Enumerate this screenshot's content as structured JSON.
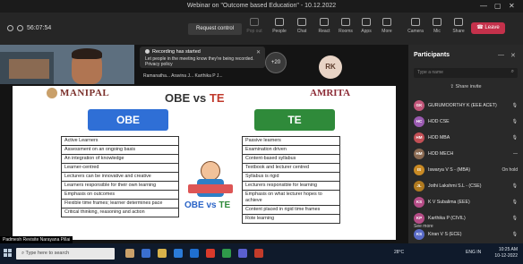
{
  "window": {
    "title": "Webinar on \"Outcome based Education\" - 10.12.2022",
    "controls": [
      "—",
      "▢",
      "✕"
    ]
  },
  "toolbar": {
    "timer": "56:07:54",
    "request_control": "Request control",
    "buttons": [
      {
        "label": "Pop out",
        "icon": "popout-icon",
        "enabled": false
      },
      {
        "label": "People",
        "icon": "people-icon",
        "enabled": true
      },
      {
        "label": "Chat",
        "icon": "chat-icon",
        "enabled": true
      },
      {
        "label": "React",
        "icon": "react-icon",
        "enabled": true
      },
      {
        "label": "Rooms",
        "icon": "rooms-icon",
        "enabled": true
      },
      {
        "label": "Apps",
        "icon": "apps-icon",
        "enabled": true
      },
      {
        "label": "More",
        "icon": "more-icon",
        "enabled": true
      },
      {
        "label": "Camera",
        "icon": "camera-icon",
        "enabled": true
      },
      {
        "label": "Mic",
        "icon": "mic-icon",
        "enabled": true
      },
      {
        "label": "Share",
        "icon": "share-icon",
        "enabled": true
      }
    ],
    "leave": "Leave"
  },
  "stage": {
    "recording_title": "Recording has started",
    "recording_body": "Let people in the meeting know they're being recorded. Privacy policy",
    "names_row": "Ramanatha...    Aravina J...    Karthika P J...",
    "more_count": "+20",
    "rk_initials": "RK",
    "presenter_name": "Padmesh Revisite Narayana Pillai"
  },
  "slide": {
    "logo_left": "MANIPAL",
    "logo_right": "AMRITA",
    "title_obe": "OBE",
    "title_vs": "vs",
    "title_te": "TE",
    "box_obe": "OBE",
    "box_te": "TE",
    "obe_list": [
      "Active Learners",
      "Assessment on an ongoing basis",
      "An integration of knowledge",
      "Learner-centred",
      "Lecturers can be innovative and creative",
      "Learners responsible for their own learning",
      "Emphasis on outcomes",
      "Flexible time frames; learner determines pace",
      "Critical thinking, reasoning and action"
    ],
    "te_list": [
      "Passive learners",
      "Examination driven",
      "Content-based syllabus",
      "Textbook and lecturer centred",
      "Syllabus is rigid",
      "Lecturers responsible for learning",
      "Emphasis on what lecturer hopes to achieve",
      "Content placed in rigid time frames",
      "Rote learning"
    ],
    "footer_obe": "OBE",
    "footer_vs": "vs",
    "footer_te": "TE"
  },
  "participants": {
    "header": "Participants",
    "search_placeholder": "Type a name",
    "share_invite": "Share invite",
    "list": [
      {
        "initials": "GK",
        "name": "GURUMOORTHY K (EEE ACET)",
        "status": "",
        "color": "#c2577a"
      },
      {
        "initials": "HC",
        "name": "HOD CSE",
        "status": "",
        "color": "#9a5ab0"
      },
      {
        "initials": "HM",
        "name": "HOD MBA",
        "status": "",
        "color": "#c24f55"
      },
      {
        "initials": "HM",
        "name": "HOD MECH",
        "status": "",
        "color": "#8a6a52"
      },
      {
        "initials": "IS",
        "name": "Iswarya V S - (MBA)",
        "status": "On hold",
        "color": "#c98a24"
      },
      {
        "initials": "JL",
        "name": "Jothi Lakshmi S.L - (CSE)",
        "status": "",
        "color": "#b07a1f"
      },
      {
        "initials": "KS",
        "name": "K V Subalima (EEE)",
        "status": "",
        "color": "#b54c86"
      },
      {
        "initials": "KP",
        "name": "Karthika P (CIVIL)",
        "status": "",
        "color": "#b54c86"
      },
      {
        "initials": "KS",
        "name": "Kiran V S (ECE)",
        "status": "",
        "color": "#5a6bc7"
      }
    ],
    "see_more": "See more"
  },
  "taskbar": {
    "search_placeholder": "Type here to search",
    "temperature": "28°C",
    "lang": "ENG\nIN",
    "time": "10:25 AM",
    "date": "10-12-2022"
  }
}
